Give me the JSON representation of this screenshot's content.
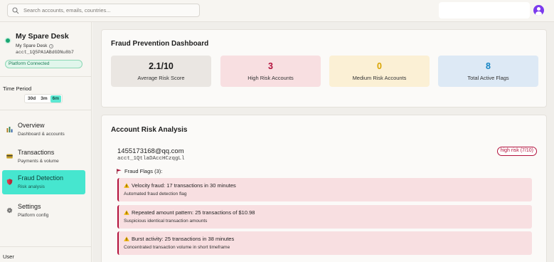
{
  "search": {
    "placeholder": "Search accounts, emails, countries..."
  },
  "sidebar": {
    "account_name": "My Spare Desk",
    "account_sub": "My Spare Desk",
    "account_id": "acct_1Q5PA1ABdGDNu8b7",
    "connection_status": "Platform Connected",
    "period_label": "Time Period",
    "periods": [
      "30d",
      "3m",
      "6m"
    ],
    "active_period": "6m",
    "nav": [
      {
        "title": "Overview",
        "sub": "Dashboard & accounts",
        "icon": "bar-chart-icon"
      },
      {
        "title": "Transactions",
        "sub": "Payments & volume",
        "icon": "credit-card-icon"
      },
      {
        "title": "Fraud Detection",
        "sub": "Risk analysis",
        "icon": "shield-icon",
        "active": true
      },
      {
        "title": "Settings",
        "sub": "Platform config",
        "icon": "gear-icon"
      }
    ],
    "user_label": "User"
  },
  "dashboard": {
    "title": "Fraud Prevention Dashboard",
    "stats": [
      {
        "value": "2.1/10",
        "label": "Average Risk Score"
      },
      {
        "value": "3",
        "label": "High Risk Accounts"
      },
      {
        "value": "0",
        "label": "Medium Risk Accounts"
      },
      {
        "value": "8",
        "label": "Total Active Flags"
      }
    ]
  },
  "analysis": {
    "title": "Account Risk Analysis",
    "account": {
      "email": "1455173168@qq.com",
      "id": "acct_1QtlaDAccHCzqgLl",
      "risk_badge": "high risk (7/10)",
      "flags_heading": "Fraud Flags (3):",
      "flags": [
        {
          "title": "Velocity fraud: 17 transactions in 30 minutes",
          "sub": "Automated fraud detection flag"
        },
        {
          "title": "Repeated amount pattern: 25 transactions of $10.98",
          "sub": "Suspicious identical transaction amounts"
        },
        {
          "title": "Burst activity: 25 transactions in 38 minutes",
          "sub": "Concentrated transaction volume in short timeframe"
        }
      ]
    }
  },
  "colors": {
    "accent": "#46e6cf",
    "high_risk": "#b3123d",
    "medium": "#d9a400",
    "flags": "#1585c4",
    "brand_avatar": "#7c3aed"
  }
}
